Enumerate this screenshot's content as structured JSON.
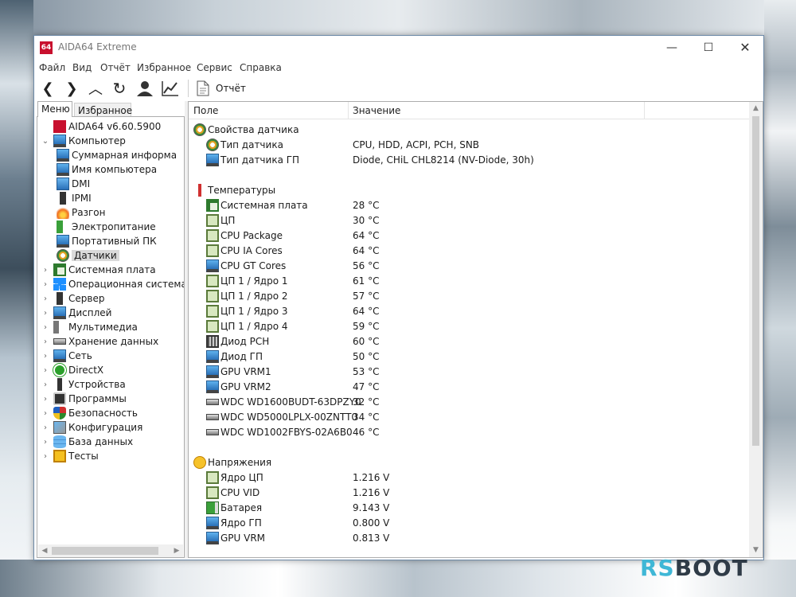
{
  "window": {
    "logo": "64",
    "title": "AIDA64 Extreme",
    "minimize": "—",
    "maximize": "☐",
    "close": "✕"
  },
  "menubar": [
    "Файл",
    "Вид",
    "Отчёт",
    "Избранное",
    "Сервис",
    "Справка"
  ],
  "toolbar": {
    "back": "❮",
    "forward": "❯",
    "up": "︿",
    "refresh": "↻",
    "user": "●",
    "chart": "⟋",
    "report_label": "Отчёт"
  },
  "leftpane": {
    "tabs": [
      "Меню",
      "Избранное"
    ],
    "tree": [
      {
        "label": "AIDA64 v6.60.5900",
        "level": 0,
        "icon": "aida64-logo-icon",
        "exp": ""
      },
      {
        "label": "Компьютер",
        "level": 0,
        "icon": "computer-icon",
        "exp": "⌄"
      },
      {
        "label": "Суммарная информа",
        "level": 1,
        "icon": "summary-icon",
        "exp": ""
      },
      {
        "label": "Имя компьютера",
        "level": 1,
        "icon": "computer-name-icon",
        "exp": ""
      },
      {
        "label": "DMI",
        "level": 1,
        "icon": "dmi-icon",
        "exp": ""
      },
      {
        "label": "IPMI",
        "level": 1,
        "icon": "ipmi-icon",
        "exp": ""
      },
      {
        "label": "Разгон",
        "level": 1,
        "icon": "overclock-icon",
        "exp": ""
      },
      {
        "label": "Электропитание",
        "level": 1,
        "icon": "power-icon",
        "exp": ""
      },
      {
        "label": "Портативный ПК",
        "level": 1,
        "icon": "laptop-icon",
        "exp": ""
      },
      {
        "label": "Датчики",
        "level": 1,
        "icon": "sensor-icon",
        "exp": "",
        "selected": true
      },
      {
        "label": "Системная плата",
        "level": 0,
        "icon": "motherboard-icon",
        "exp": "›"
      },
      {
        "label": "Операционная система",
        "level": 0,
        "icon": "windows-icon",
        "exp": "›"
      },
      {
        "label": "Сервер",
        "level": 0,
        "icon": "server-icon",
        "exp": "›"
      },
      {
        "label": "Дисплей",
        "level": 0,
        "icon": "display-icon",
        "exp": "›"
      },
      {
        "label": "Мультимедиа",
        "level": 0,
        "icon": "speaker-icon",
        "exp": "›"
      },
      {
        "label": "Хранение данных",
        "level": 0,
        "icon": "storage-icon",
        "exp": "›"
      },
      {
        "label": "Сеть",
        "level": 0,
        "icon": "network-icon",
        "exp": "›"
      },
      {
        "label": "DirectX",
        "level": 0,
        "icon": "directx-icon",
        "exp": "›"
      },
      {
        "label": "Устройства",
        "level": 0,
        "icon": "devices-icon",
        "exp": "›"
      },
      {
        "label": "Программы",
        "level": 0,
        "icon": "programs-icon",
        "exp": "›"
      },
      {
        "label": "Безопасность",
        "level": 0,
        "icon": "security-icon",
        "exp": "›"
      },
      {
        "label": "Конфигурация",
        "level": 0,
        "icon": "config-icon",
        "exp": "›"
      },
      {
        "label": "База данных",
        "level": 0,
        "icon": "database-icon",
        "exp": "›"
      },
      {
        "label": "Тесты",
        "level": 0,
        "icon": "benchmark-icon",
        "exp": "›"
      }
    ]
  },
  "columns": {
    "field": "Поле",
    "value": "Значение"
  },
  "rows": [
    {
      "type": "group",
      "field": "Свойства датчика",
      "icon": "sensor-icon"
    },
    {
      "type": "item",
      "field": "Тип датчика",
      "value": "CPU, HDD, ACPI, PCH, SNB",
      "icon": "sensor-icon"
    },
    {
      "type": "item",
      "field": "Тип датчика ГП",
      "value": "Diode, CHiL CHL8214  (NV-Diode, 30h)",
      "icon": "monitor-icon"
    },
    {
      "type": "spacer"
    },
    {
      "type": "group",
      "field": "Температуры",
      "icon": "thermometer-icon"
    },
    {
      "type": "item",
      "field": "Системная плата",
      "value": "28 °C",
      "icon": "motherboard-icon"
    },
    {
      "type": "item",
      "field": "ЦП",
      "value": "30 °C",
      "icon": "chip-icon"
    },
    {
      "type": "item",
      "field": "CPU Package",
      "value": "64 °C",
      "icon": "chip-icon"
    },
    {
      "type": "item",
      "field": "CPU IA Cores",
      "value": "64 °C",
      "icon": "chip-icon"
    },
    {
      "type": "item",
      "field": "CPU GT Cores",
      "value": "56 °C",
      "icon": "monitor-icon"
    },
    {
      "type": "item",
      "field": "ЦП 1 / Ядро 1",
      "value": "61 °C",
      "icon": "chip-icon"
    },
    {
      "type": "item",
      "field": "ЦП 1 / Ядро 2",
      "value": "57 °C",
      "icon": "chip-icon"
    },
    {
      "type": "item",
      "field": "ЦП 1 / Ядро 3",
      "value": "64 °C",
      "icon": "chip-icon"
    },
    {
      "type": "item",
      "field": "ЦП 1 / Ядро 4",
      "value": "59 °C",
      "icon": "chip-icon"
    },
    {
      "type": "item",
      "field": "Диод PCH",
      "value": "60 °C",
      "icon": "pch-icon"
    },
    {
      "type": "item",
      "field": "Диод ГП",
      "value": "50 °C",
      "icon": "monitor-icon"
    },
    {
      "type": "item",
      "field": "GPU VRM1",
      "value": "53 °C",
      "icon": "monitor-icon"
    },
    {
      "type": "item",
      "field": "GPU VRM2",
      "value": "47 °C",
      "icon": "monitor-icon"
    },
    {
      "type": "item",
      "field": "WDC WD1600BUDT-63DPZY0",
      "value": "32 °C",
      "icon": "hdd-icon"
    },
    {
      "type": "item",
      "field": "WDC WD5000LPLX-00ZNTT0",
      "value": "34 °C",
      "icon": "hdd-icon"
    },
    {
      "type": "item",
      "field": "WDC WD1002FBYS-02A6B0",
      "value": "46 °C",
      "icon": "hdd-icon"
    },
    {
      "type": "spacer"
    },
    {
      "type": "group",
      "field": "Напряжения",
      "icon": "voltage-icon"
    },
    {
      "type": "item",
      "field": "Ядро ЦП",
      "value": "1.216 V",
      "icon": "chip-icon"
    },
    {
      "type": "item",
      "field": "CPU VID",
      "value": "1.216 V",
      "icon": "chip-icon"
    },
    {
      "type": "item",
      "field": "Батарея",
      "value": "9.143 V",
      "icon": "battery-icon"
    },
    {
      "type": "item",
      "field": "Ядро ГП",
      "value": "0.800 V",
      "icon": "monitor-icon"
    },
    {
      "type": "item",
      "field": "GPU VRM",
      "value": "0.813 V",
      "icon": "monitor-icon"
    }
  ],
  "scroll_arrows": {
    "up": "▲",
    "down": "▼",
    "left": "◀",
    "right": "▶"
  },
  "watermark": {
    "part1": "RS",
    "part2": "BOOT"
  },
  "colors": {
    "app_logo": "#c8102e",
    "selection": "#dadada",
    "watermark_accent": "#3fb7d6"
  }
}
